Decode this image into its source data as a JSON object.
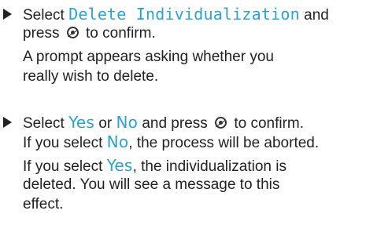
{
  "steps": [
    {
      "lines": [
        {
          "prefix": "Select ",
          "menu_item": "Delete Individualization",
          "suffix": " and"
        },
        {
          "before_icon": "press ",
          "icon": "confirm-button-icon",
          "after_icon": " to confirm."
        },
        {
          "text": "A prompt appears asking whether you"
        },
        {
          "text": "really wish to delete."
        }
      ]
    },
    {
      "lines": [
        {
          "prefix": "Select ",
          "option_yes": "Yes",
          "middle": " or ",
          "option_no": "No",
          "before_icon": " and press ",
          "icon": "confirm-button-icon",
          "after_icon": " to confirm."
        },
        {
          "prefix": "If you select ",
          "option_no": "No",
          "suffix": ", the process will be aborted."
        },
        {
          "prefix": "If you select ",
          "option_yes": "Yes",
          "suffix": ", the individualization is"
        },
        {
          "text": "deleted. You will see a message to this"
        },
        {
          "text": "effect."
        }
      ]
    }
  ],
  "colors": {
    "text": "#222222",
    "menu_highlight": "#2aa3d3",
    "background": "#ffffff"
  },
  "icons": {
    "step_marker": "right-triangle-bullet-icon",
    "confirm": "confirm-button-icon"
  }
}
